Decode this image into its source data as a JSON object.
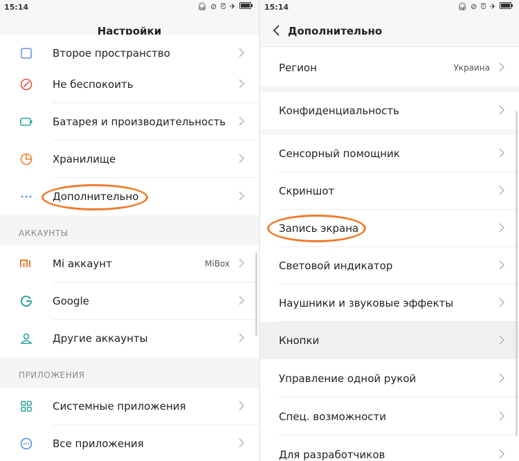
{
  "status_bar": {
    "time": "15:14"
  },
  "left_screen": {
    "title": "Настройки",
    "items": [
      {
        "label": "Второе пространство",
        "icon": "second-space-icon"
      },
      {
        "label": "Не беспокоить",
        "icon": "do-not-disturb-icon"
      },
      {
        "label": "Батарея и производительность",
        "icon": "battery-icon"
      },
      {
        "label": "Хранилище",
        "icon": "storage-icon"
      },
      {
        "label": "Дополнительно",
        "icon": "more-dots-icon"
      }
    ],
    "accounts_section": {
      "title": "АККАУНТЫ",
      "items": [
        {
          "label": "Mi аккаунт",
          "value": "MiBox",
          "icon": "mi-logo-icon"
        },
        {
          "label": "Google",
          "icon": "google-icon"
        },
        {
          "label": "Другие аккаунты",
          "icon": "person-icon"
        }
      ]
    },
    "apps_section": {
      "title": "ПРИЛОЖЕНИЯ",
      "items": [
        {
          "label": "Системные приложения",
          "icon": "apps-grid-icon"
        },
        {
          "label": "Все приложения",
          "icon": "all-apps-icon"
        }
      ]
    }
  },
  "right_screen": {
    "title": "Дополнительно",
    "region": {
      "label": "Регион",
      "value": "Украина"
    },
    "privacy": {
      "label": "Конфиденциальность"
    },
    "items": [
      {
        "label": "Сенсорный помощник"
      },
      {
        "label": "Скриншот"
      },
      {
        "label": "Запись экрана"
      },
      {
        "label": "Световой индикатор"
      },
      {
        "label": "Наушники и звуковые эффекты"
      },
      {
        "label": "Кнопки"
      },
      {
        "label": "Управление одной рукой"
      },
      {
        "label": "Спец. возможности"
      },
      {
        "label": "Для разработчиков"
      }
    ]
  },
  "colors": {
    "highlight": "#f07a2a",
    "accent_orange": "#f07a2a",
    "accent_teal": "#2aa39a",
    "divider": "#ececec"
  }
}
